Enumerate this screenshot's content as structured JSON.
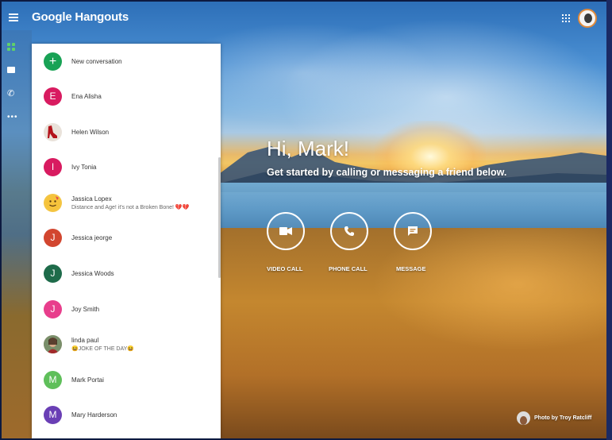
{
  "app": {
    "title": "Google Hangouts"
  },
  "conversations": {
    "new_label": "New conversation",
    "items": [
      {
        "name": "Ena Alisha",
        "initial": "E",
        "color": "#d81b60",
        "subtitle": ""
      },
      {
        "name": "Helen Wilson",
        "initial": "",
        "color": "#e9e2da",
        "subtitle": "",
        "avatar": "high-heel-photo"
      },
      {
        "name": "Ivy Tonia",
        "initial": "I",
        "color": "#d81b60",
        "subtitle": ""
      },
      {
        "name": "Jassica Lopex",
        "initial": "",
        "color": "#f4c542",
        "subtitle": "Distance and Age! it's not a Broken Bone! 💔💔",
        "avatar": "emoji-photo"
      },
      {
        "name": "Jessica jeorge",
        "initial": "J",
        "color": "#d2462f",
        "subtitle": ""
      },
      {
        "name": "Jessica Woods",
        "initial": "J",
        "color": "#1e6b4a",
        "subtitle": ""
      },
      {
        "name": "Joy Smith",
        "initial": "J",
        "color": "#e83e8c",
        "subtitle": ""
      },
      {
        "name": "linda paul",
        "initial": "",
        "color": "#cfa58a",
        "subtitle": "😆JOKE OF THE DAY😆",
        "avatar": "portrait-photo"
      },
      {
        "name": "Mark Portai",
        "initial": "M",
        "color": "#5fbf5a",
        "subtitle": ""
      },
      {
        "name": "Mary Harderson",
        "initial": "M",
        "color": "#6a3fb5",
        "subtitle": ""
      }
    ]
  },
  "hero": {
    "greeting": "Hi, Mark!",
    "subtitle": "Get started by calling or messaging a friend below.",
    "actions": [
      {
        "label": "VIDEO CALL",
        "icon": "video-icon"
      },
      {
        "label": "PHONE CALL",
        "icon": "phone-icon"
      },
      {
        "label": "MESSAGE",
        "icon": "message-icon"
      }
    ]
  },
  "credit": {
    "text": "Photo by Troy Ratcliff"
  },
  "icons": {
    "menu": "menu-icon",
    "apps": "apps-grid-icon",
    "contacts": "contacts-icon",
    "messages": "message-icon",
    "phone": "phone-icon",
    "more": "more-icon"
  }
}
